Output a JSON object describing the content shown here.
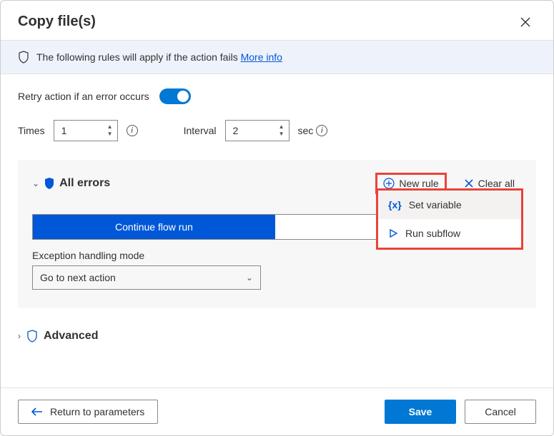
{
  "header": {
    "title": "Copy file(s)"
  },
  "banner": {
    "text": "The following rules will apply if the action fails ",
    "link": "More info"
  },
  "retry": {
    "label": "Retry action if an error occurs",
    "times_label": "Times",
    "times_value": "1",
    "interval_label": "Interval",
    "interval_value": "2",
    "unit": "sec"
  },
  "panel": {
    "title": "All errors",
    "new_rule": "New rule",
    "clear_all": "Clear all",
    "menu": {
      "set_variable": "Set variable",
      "run_subflow": "Run subflow"
    },
    "segment_active": "Continue flow run",
    "handling_label": "Exception handling mode",
    "handling_value": "Go to next action"
  },
  "advanced": {
    "title": "Advanced"
  },
  "footer": {
    "return": "Return to parameters",
    "save": "Save",
    "cancel": "Cancel"
  }
}
